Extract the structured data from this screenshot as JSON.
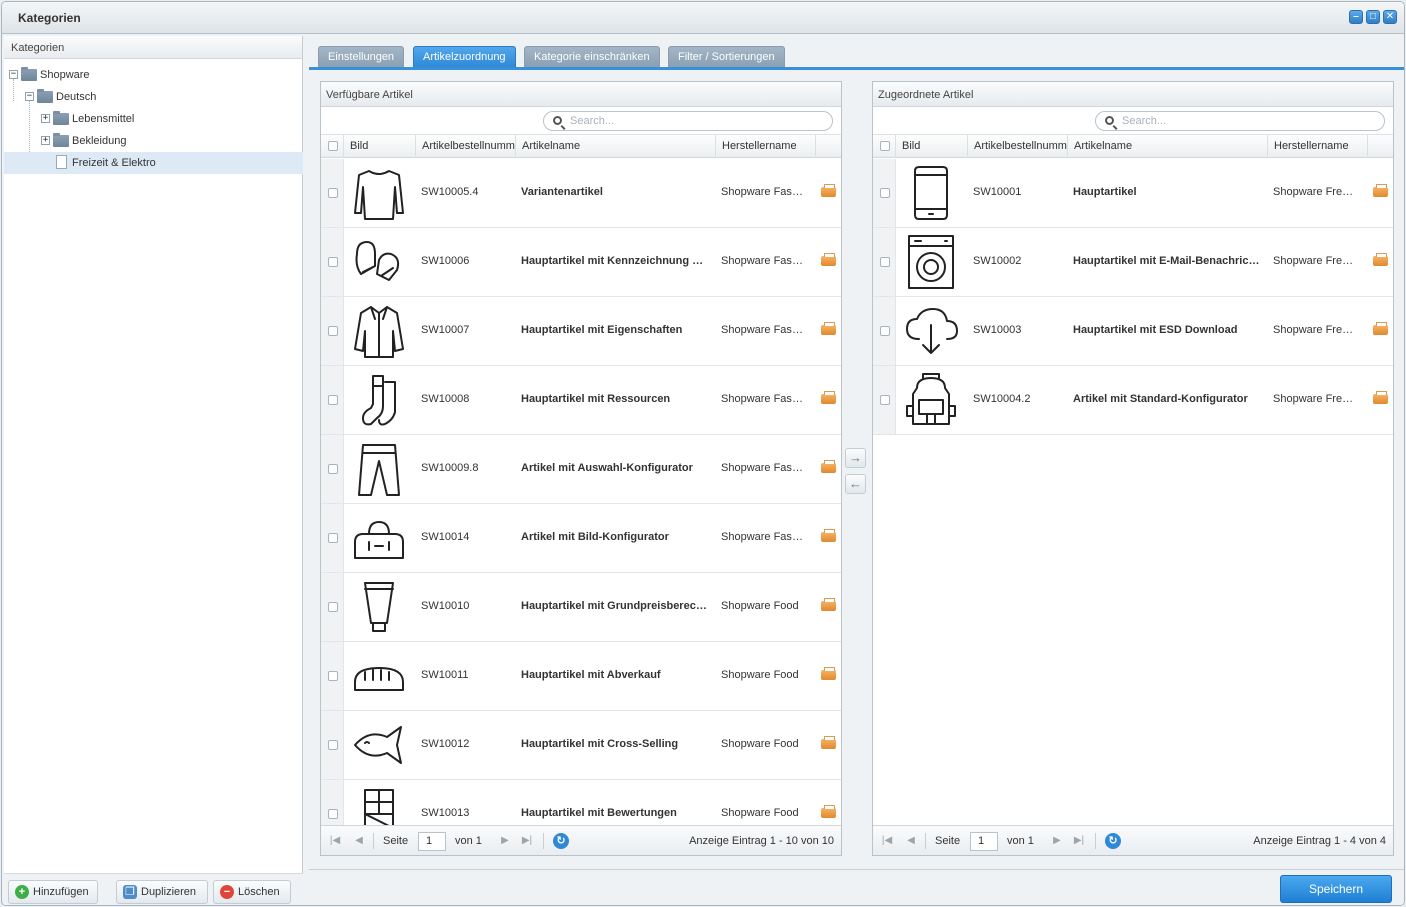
{
  "window": {
    "title": "Kategorien"
  },
  "tree": {
    "header": "Kategorien",
    "nodes": [
      "Shopware",
      "Deutsch",
      "Lebensmittel",
      "Bekleidung",
      "Freizeit & Elektro"
    ]
  },
  "left_buttons": {
    "add": "Hinzufügen",
    "duplicate": "Duplizieren",
    "delete": "Löschen"
  },
  "tabs": [
    "Einstellungen",
    "Artikelzuordnung",
    "Kategorie einschränken",
    "Filter / Sortierungen"
  ],
  "available": {
    "title": "Verfügbare Artikel",
    "search_placeholder": "Search...",
    "columns": [
      "Bild",
      "Artikelbestellnummer",
      "Artikelname",
      "Herstellername"
    ],
    "rows": [
      {
        "nr": "SW10005.4",
        "name": "Variantenartikel",
        "maker": "Shopware Fashion",
        "icon": "sweater-icon"
      },
      {
        "nr": "SW10006",
        "name": "Hauptartikel mit Kennzeichnung als Neuheit",
        "maker": "Shopware Fashion",
        "icon": "mittens-icon"
      },
      {
        "nr": "SW10007",
        "name": "Hauptartikel mit Eigenschaften",
        "maker": "Shopware Fashion",
        "icon": "jacket-icon"
      },
      {
        "nr": "SW10008",
        "name": "Hauptartikel mit Ressourcen",
        "maker": "Shopware Fashion",
        "icon": "socks-icon"
      },
      {
        "nr": "SW10009.8",
        "name": "Artikel mit Auswahl-Konfigurator",
        "maker": "Shopware Fashion",
        "icon": "pants-icon"
      },
      {
        "nr": "SW10014",
        "name": "Artikel mit Bild-Konfigurator",
        "maker": "Shopware Fashion",
        "icon": "bag-icon"
      },
      {
        "nr": "SW10010",
        "name": "Hauptartikel mit Grundpreisberechnung",
        "maker": "Shopware Food",
        "icon": "tube-icon"
      },
      {
        "nr": "SW10011",
        "name": "Hauptartikel mit Abverkauf",
        "maker": "Shopware Food",
        "icon": "bread-icon"
      },
      {
        "nr": "SW10012",
        "name": "Hauptartikel mit Cross-Selling",
        "maker": "Shopware Food",
        "icon": "fish-icon"
      },
      {
        "nr": "SW10013",
        "name": "Hauptartikel mit Bewertungen",
        "maker": "Shopware Food",
        "icon": "chocolate-icon"
      }
    ],
    "pager": {
      "page_label": "Seite",
      "page": "1",
      "of": "von 1",
      "info": "Anzeige Eintrag 1 - 10 von 10"
    }
  },
  "assigned": {
    "title": "Zugeordnete Artikel",
    "search_placeholder": "Search...",
    "columns": [
      "Bild",
      "Artikelbestellnummer",
      "Artikelname",
      "Herstellername"
    ],
    "rows": [
      {
        "nr": "SW10001",
        "name": "Hauptartikel",
        "maker": "Shopware Freetime",
        "icon": "smartphone-icon"
      },
      {
        "nr": "SW10002",
        "name": "Hauptartikel mit E-Mail-Benachrichtigung",
        "maker": "Shopware Freetime",
        "icon": "washing-machine-icon"
      },
      {
        "nr": "SW10003",
        "name": "Hauptartikel mit ESD Download",
        "maker": "Shopware Freetime",
        "icon": "cloud-download-icon"
      },
      {
        "nr": "SW10004.2",
        "name": "Artikel mit Standard-Konfigurator",
        "maker": "Shopware Freetime",
        "icon": "backpack-icon"
      }
    ],
    "pager": {
      "page_label": "Seite",
      "page": "1",
      "of": "von 1",
      "info": "Anzeige Eintrag 1 - 4 von 4"
    }
  },
  "save_label": "Speichern"
}
